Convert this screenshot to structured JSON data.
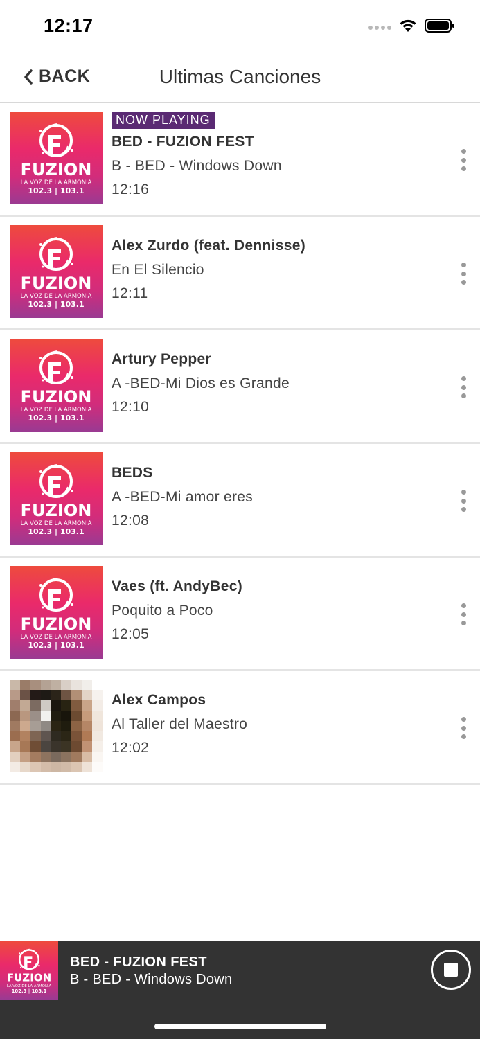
{
  "status_bar": {
    "time": "12:17"
  },
  "nav": {
    "back_label": "BACK",
    "title": "Ultimas Canciones"
  },
  "now_playing_badge": "NOW PLAYING",
  "logo": {
    "brand": "FUZION",
    "tagline": "LA VOZ DE LA ARMONIA",
    "frequencies": "102.3 | 103.1"
  },
  "songs": [
    {
      "artist": "BED - FUZION FEST",
      "title": "B - BED - Windows Down",
      "time": "12:16",
      "now_playing": true,
      "artwork": "fuzion-logo"
    },
    {
      "artist": "Alex Zurdo (feat. Dennisse)",
      "title": "En El Silencio",
      "time": "12:11",
      "now_playing": false,
      "artwork": "fuzion-logo"
    },
    {
      "artist": "Artury Pepper",
      "title": "A -BED-Mi Dios es Grande",
      "time": "12:10",
      "now_playing": false,
      "artwork": "fuzion-logo"
    },
    {
      "artist": "BEDS",
      "title": "A -BED-Mi amor eres",
      "time": "12:08",
      "now_playing": false,
      "artwork": "fuzion-logo"
    },
    {
      "artist": "Vaes (ft. AndyBec)",
      "title": "Poquito a Poco",
      "time": "12:05",
      "now_playing": false,
      "artwork": "fuzion-logo"
    },
    {
      "artist": "Alex Campos",
      "title": "Al Taller del Maestro",
      "time": "12:02",
      "now_playing": false,
      "artwork": "album-photo"
    }
  ],
  "mini_player": {
    "artist": "BED - FUZION FEST",
    "title": "B - BED - Windows Down"
  },
  "colors": {
    "badge": "#5a2a73",
    "player_bg": "#333333",
    "logo_top": "#ee4b3d",
    "logo_bottom": "#9a3a92"
  }
}
